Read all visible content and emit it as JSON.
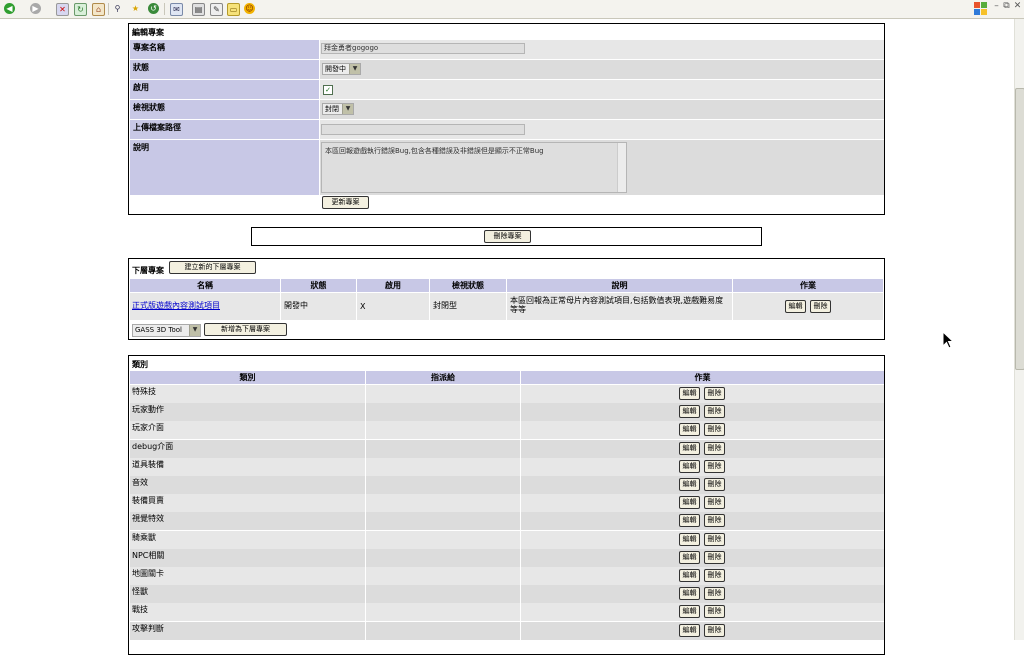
{
  "browser": {
    "toolbar_icons": [
      "back-icon",
      "forward-icon",
      "stop-icon",
      "refresh-icon",
      "home-icon",
      "search-icon",
      "favorites-icon",
      "history-icon",
      "mail-icon",
      "print-icon",
      "edit-icon",
      "discuss-icon",
      "messenger-icon"
    ]
  },
  "edit_project": {
    "title": "編輯專案",
    "fields": {
      "name_label": "專案名稱",
      "name_value": "拜金勇者gogogo",
      "status_label": "狀態",
      "status_value": "開發中",
      "enabled_label": "啟用",
      "enabled_checked": true,
      "view_status_label": "檢視狀態",
      "view_status_value": "封閉",
      "upload_path_label": "上傳檔案路徑",
      "upload_path_value": "",
      "desc_label": "說明",
      "desc_value": "本區回報遊戲執行錯誤Bug,包含各種錯誤及非錯誤但是顯示不正常Bug"
    },
    "update_button": "更新專案"
  },
  "delete_project_button": "刪除專案",
  "subprojects": {
    "title": "下層專案",
    "new_button": "建立新的下層專案",
    "headers": [
      "名稱",
      "狀態",
      "啟用",
      "檢視狀態",
      "說明",
      "作業"
    ],
    "rows": [
      {
        "name": "正式版遊戲內容測試項目",
        "status": "開發中",
        "enabled": "X",
        "view_status": "封閉型",
        "description": "本區回報為正常母片內容測試項目,包括數值表現,遊戲難易度等等",
        "edit": "編輯",
        "delete": "刪除"
      }
    ],
    "add_select_value": "GASS 3D Tool",
    "add_button": "新增為下層專案"
  },
  "categories": {
    "title": "類別",
    "headers": [
      "類別",
      "指派給",
      "作業"
    ],
    "edit_label": "編輯",
    "delete_label": "刪除",
    "rows": [
      "特殊技",
      "玩家動作",
      "玩家介面",
      "debug介面",
      "道具裝備",
      "音效",
      "裝備買賣",
      "視覺特效",
      "騎乘獸",
      "NPC相關",
      "地圖關卡",
      "怪獸",
      "戰技",
      "攻擊判斷"
    ]
  }
}
